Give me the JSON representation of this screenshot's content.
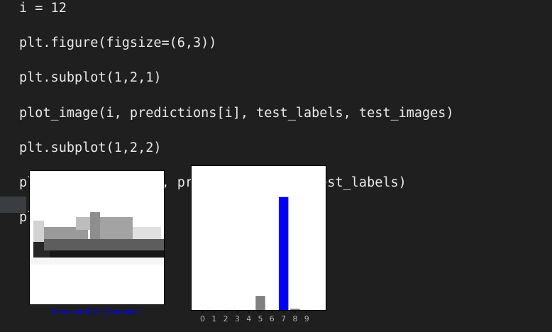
{
  "code": {
    "lines": [
      "i = 12",
      "plt.figure(figsize=(6,3))",
      "plt.subplot(1,2,1)",
      "plot_image(i, predictions[i], test_labels, test_images)",
      "plt.subplot(1,2,2)",
      "plot_value_array(i, predictions[i],  test_labels)",
      "plt.show()"
    ]
  },
  "figure": {
    "image_icon": "sneaker-image",
    "caption": "Sneaker 88% (Sneaker)",
    "caption_color": "#0000ff"
  },
  "chart_data": {
    "type": "bar",
    "categories": [
      "0",
      "1",
      "2",
      "3",
      "4",
      "5",
      "6",
      "7",
      "8",
      "9"
    ],
    "values": [
      0,
      0,
      0,
      0,
      0,
      0.11,
      0,
      0.88,
      0.01,
      0
    ],
    "ylim": [
      0,
      1
    ],
    "bar_color": "#808080",
    "predicted_color": "#0000ff",
    "predicted_index": 7,
    "grid": false
  }
}
